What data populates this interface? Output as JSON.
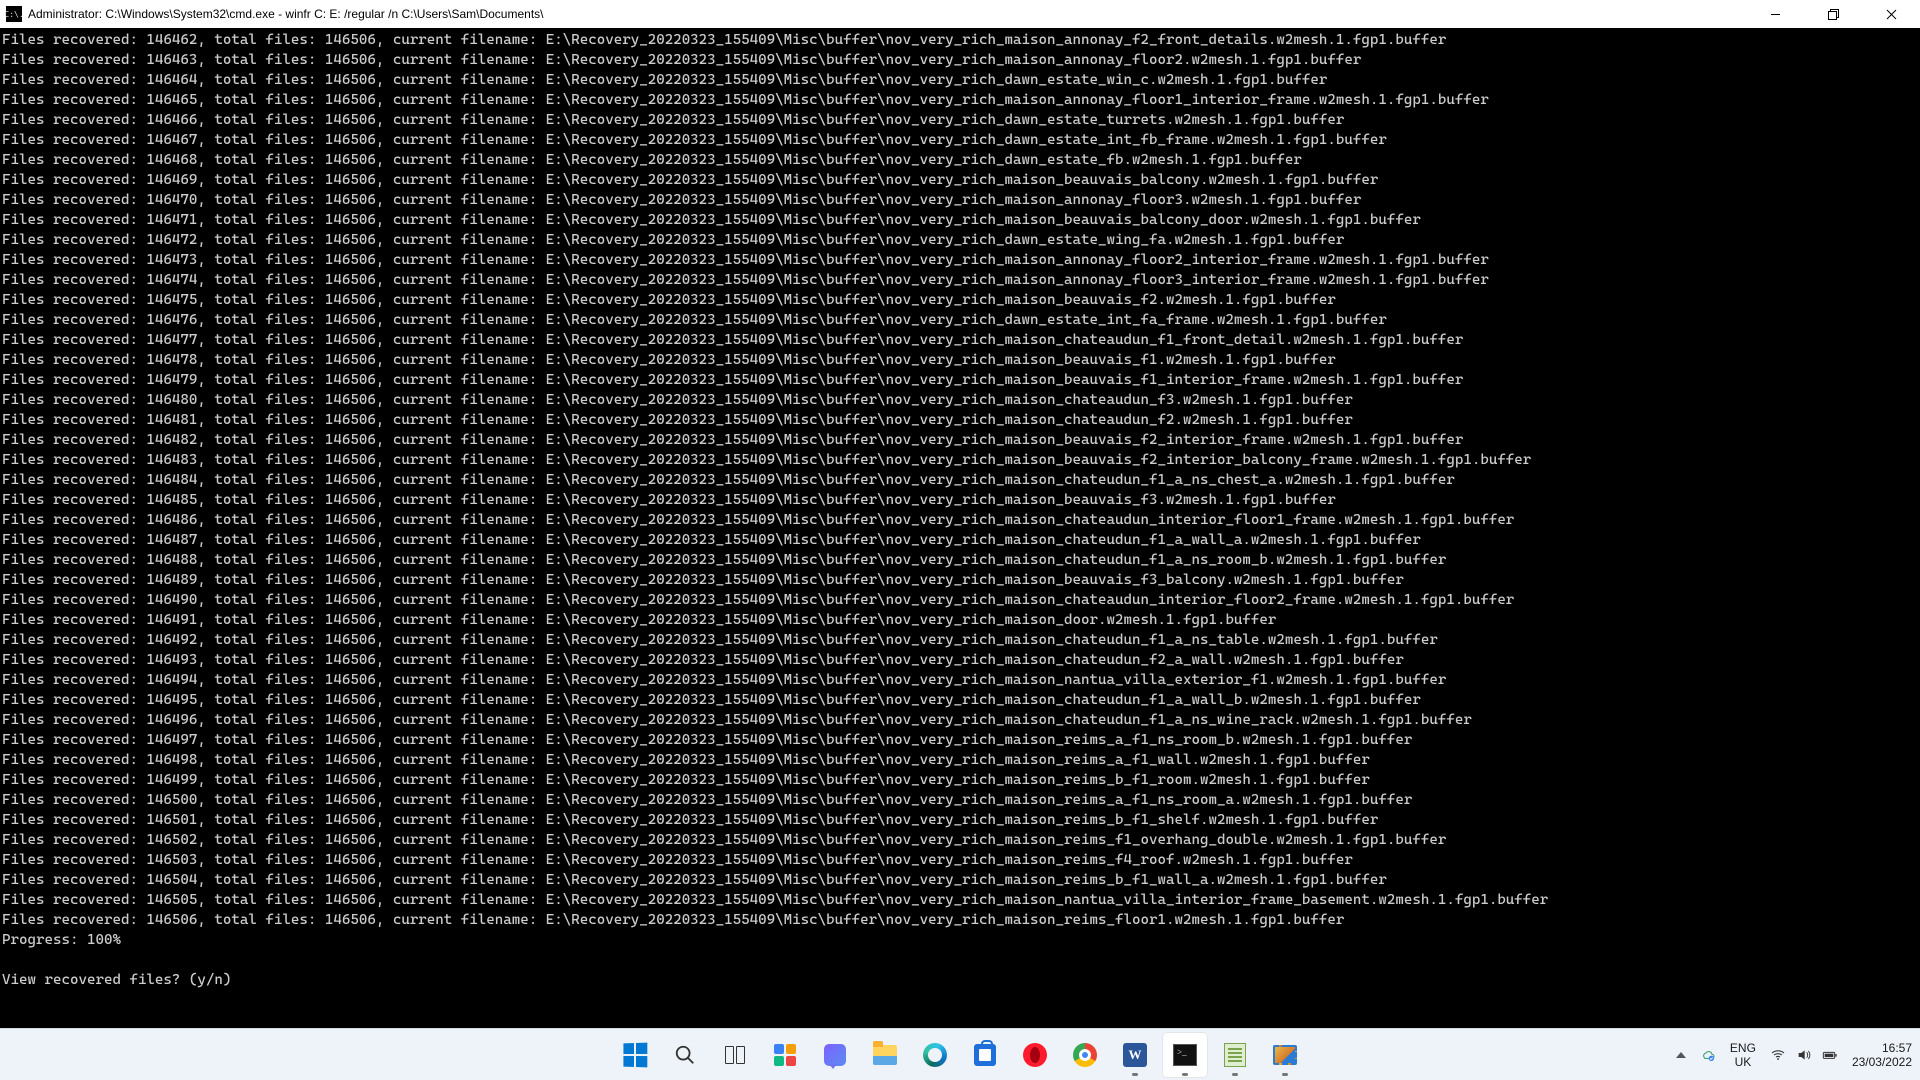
{
  "window": {
    "title": "Administrator: C:\\Windows\\System32\\cmd.exe - winfr  C: E: /regular /n C:\\Users\\Sam\\Documents\\",
    "icon_label": "C:\\."
  },
  "total_files": 146506,
  "recovery_path_prefix": "E:\\Recovery_20220323_155409\\Misc\\buffer\\",
  "lines": [
    {
      "n": 146462,
      "f": "nov_very_rich_maison_annonay_f2_front_details.w2mesh.1.fgp1.buffer"
    },
    {
      "n": 146463,
      "f": "nov_very_rich_maison_annonay_floor2.w2mesh.1.fgp1.buffer"
    },
    {
      "n": 146464,
      "f": "nov_very_rich_dawn_estate_win_c.w2mesh.1.fgp1.buffer"
    },
    {
      "n": 146465,
      "f": "nov_very_rich_maison_annonay_floor1_interior_frame.w2mesh.1.fgp1.buffer"
    },
    {
      "n": 146466,
      "f": "nov_very_rich_dawn_estate_turrets.w2mesh.1.fgp1.buffer"
    },
    {
      "n": 146467,
      "f": "nov_very_rich_dawn_estate_int_fb_frame.w2mesh.1.fgp1.buffer"
    },
    {
      "n": 146468,
      "f": "nov_very_rich_dawn_estate_fb.w2mesh.1.fgp1.buffer"
    },
    {
      "n": 146469,
      "f": "nov_very_rich_maison_beauvais_balcony.w2mesh.1.fgp1.buffer"
    },
    {
      "n": 146470,
      "f": "nov_very_rich_maison_annonay_floor3.w2mesh.1.fgp1.buffer"
    },
    {
      "n": 146471,
      "f": "nov_very_rich_maison_beauvais_balcony_door.w2mesh.1.fgp1.buffer"
    },
    {
      "n": 146472,
      "f": "nov_very_rich_dawn_estate_wing_fa.w2mesh.1.fgp1.buffer"
    },
    {
      "n": 146473,
      "f": "nov_very_rich_maison_annonay_floor2_interior_frame.w2mesh.1.fgp1.buffer"
    },
    {
      "n": 146474,
      "f": "nov_very_rich_maison_annonay_floor3_interior_frame.w2mesh.1.fgp1.buffer"
    },
    {
      "n": 146475,
      "f": "nov_very_rich_maison_beauvais_f2.w2mesh.1.fgp1.buffer"
    },
    {
      "n": 146476,
      "f": "nov_very_rich_dawn_estate_int_fa_frame.w2mesh.1.fgp1.buffer"
    },
    {
      "n": 146477,
      "f": "nov_very_rich_maison_chateaudun_f1_front_detail.w2mesh.1.fgp1.buffer"
    },
    {
      "n": 146478,
      "f": "nov_very_rich_maison_beauvais_f1.w2mesh.1.fgp1.buffer"
    },
    {
      "n": 146479,
      "f": "nov_very_rich_maison_beauvais_f1_interior_frame.w2mesh.1.fgp1.buffer"
    },
    {
      "n": 146480,
      "f": "nov_very_rich_maison_chateaudun_f3.w2mesh.1.fgp1.buffer"
    },
    {
      "n": 146481,
      "f": "nov_very_rich_maison_chateaudun_f2.w2mesh.1.fgp1.buffer"
    },
    {
      "n": 146482,
      "f": "nov_very_rich_maison_beauvais_f2_interior_frame.w2mesh.1.fgp1.buffer"
    },
    {
      "n": 146483,
      "f": "nov_very_rich_maison_beauvais_f2_interior_balcony_frame.w2mesh.1.fgp1.buffer"
    },
    {
      "n": 146484,
      "f": "nov_very_rich_maison_chateudun_f1_a_ns_chest_a.w2mesh.1.fgp1.buffer"
    },
    {
      "n": 146485,
      "f": "nov_very_rich_maison_beauvais_f3.w2mesh.1.fgp1.buffer"
    },
    {
      "n": 146486,
      "f": "nov_very_rich_maison_chateaudun_interior_floor1_frame.w2mesh.1.fgp1.buffer"
    },
    {
      "n": 146487,
      "f": "nov_very_rich_maison_chateudun_f1_a_wall_a.w2mesh.1.fgp1.buffer"
    },
    {
      "n": 146488,
      "f": "nov_very_rich_maison_chateudun_f1_a_ns_room_b.w2mesh.1.fgp1.buffer"
    },
    {
      "n": 146489,
      "f": "nov_very_rich_maison_beauvais_f3_balcony.w2mesh.1.fgp1.buffer"
    },
    {
      "n": 146490,
      "f": "nov_very_rich_maison_chateaudun_interior_floor2_frame.w2mesh.1.fgp1.buffer"
    },
    {
      "n": 146491,
      "f": "nov_very_rich_maison_door.w2mesh.1.fgp1.buffer"
    },
    {
      "n": 146492,
      "f": "nov_very_rich_maison_chateudun_f1_a_ns_table.w2mesh.1.fgp1.buffer"
    },
    {
      "n": 146493,
      "f": "nov_very_rich_maison_chateudun_f2_a_wall.w2mesh.1.fgp1.buffer"
    },
    {
      "n": 146494,
      "f": "nov_very_rich_maison_nantua_villa_exterior_f1.w2mesh.1.fgp1.buffer"
    },
    {
      "n": 146495,
      "f": "nov_very_rich_maison_chateudun_f1_a_wall_b.w2mesh.1.fgp1.buffer"
    },
    {
      "n": 146496,
      "f": "nov_very_rich_maison_chateudun_f1_a_ns_wine_rack.w2mesh.1.fgp1.buffer"
    },
    {
      "n": 146497,
      "f": "nov_very_rich_maison_reims_a_f1_ns_room_b.w2mesh.1.fgp1.buffer"
    },
    {
      "n": 146498,
      "f": "nov_very_rich_maison_reims_a_f1_wall.w2mesh.1.fgp1.buffer"
    },
    {
      "n": 146499,
      "f": "nov_very_rich_maison_reims_b_f1_room.w2mesh.1.fgp1.buffer"
    },
    {
      "n": 146500,
      "f": "nov_very_rich_maison_reims_a_f1_ns_room_a.w2mesh.1.fgp1.buffer"
    },
    {
      "n": 146501,
      "f": "nov_very_rich_maison_reims_b_f1_shelf.w2mesh.1.fgp1.buffer"
    },
    {
      "n": 146502,
      "f": "nov_very_rich_maison_reims_f1_overhang_double.w2mesh.1.fgp1.buffer"
    },
    {
      "n": 146503,
      "f": "nov_very_rich_maison_reims_f4_roof.w2mesh.1.fgp1.buffer"
    },
    {
      "n": 146504,
      "f": "nov_very_rich_maison_reims_b_f1_wall_a.w2mesh.1.fgp1.buffer"
    },
    {
      "n": 146505,
      "f": "nov_very_rich_maison_nantua_villa_interior_frame_basement.w2mesh.1.fgp1.buffer"
    },
    {
      "n": 146506,
      "f": "nov_very_rich_maison_reims_floor1.w2mesh.1.fgp1.buffer"
    }
  ],
  "progress_line": "Progress: 100%",
  "prompt_line": "View recovered files? (y/n)",
  "taskbar": {
    "apps": [
      {
        "name": "start-button",
        "kind": "winlogo"
      },
      {
        "name": "search-button",
        "kind": "search"
      },
      {
        "name": "task-view-button",
        "kind": "taskview"
      },
      {
        "name": "widgets-button",
        "kind": "widgets"
      },
      {
        "name": "chat-button",
        "kind": "chat"
      },
      {
        "name": "file-explorer-button",
        "kind": "explorer"
      },
      {
        "name": "edge-button",
        "kind": "edge"
      },
      {
        "name": "store-button",
        "kind": "store"
      },
      {
        "name": "opera-button",
        "kind": "opera"
      },
      {
        "name": "chrome-button",
        "kind": "chrome"
      },
      {
        "name": "word-button",
        "kind": "word",
        "running": true
      },
      {
        "name": "cmd-button",
        "kind": "cmd",
        "running": true,
        "active": true
      },
      {
        "name": "notepadpp-button",
        "kind": "npp",
        "running": true
      },
      {
        "name": "snipping-tool-button",
        "kind": "snip",
        "running": true
      }
    ],
    "lang_top": "ENG",
    "lang_bottom": "UK",
    "time": "16:57",
    "date": "23/03/2022"
  }
}
